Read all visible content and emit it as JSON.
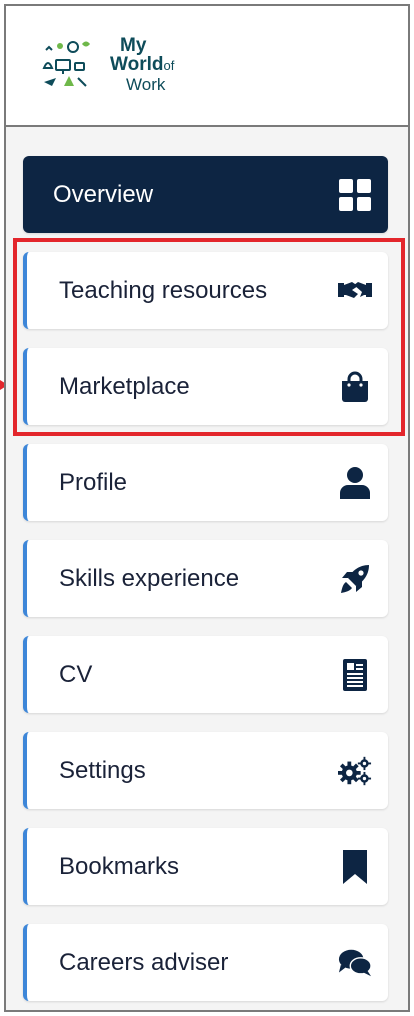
{
  "logo": {
    "line1": "My",
    "line2": "World",
    "line2_small": "of",
    "line3": "Work"
  },
  "colors": {
    "active_bg": "#0d2543",
    "accent_bar": "#3d86d8",
    "highlight": "#e3262c",
    "icon": "#0d2543"
  },
  "menu": {
    "overview": {
      "label": "Overview",
      "icon": "grid-icon"
    },
    "items": [
      {
        "label": "Teaching resources",
        "icon": "handshake-icon"
      },
      {
        "label": "Marketplace",
        "icon": "shopping-bag-icon"
      },
      {
        "label": "Profile",
        "icon": "user-icon"
      },
      {
        "label": "Skills experience",
        "icon": "rocket-icon"
      },
      {
        "label": "CV",
        "icon": "document-icon"
      },
      {
        "label": "Settings",
        "icon": "gears-icon"
      },
      {
        "label": "Bookmarks",
        "icon": "bookmark-icon"
      },
      {
        "label": "Careers adviser",
        "icon": "chat-icon"
      }
    ]
  }
}
